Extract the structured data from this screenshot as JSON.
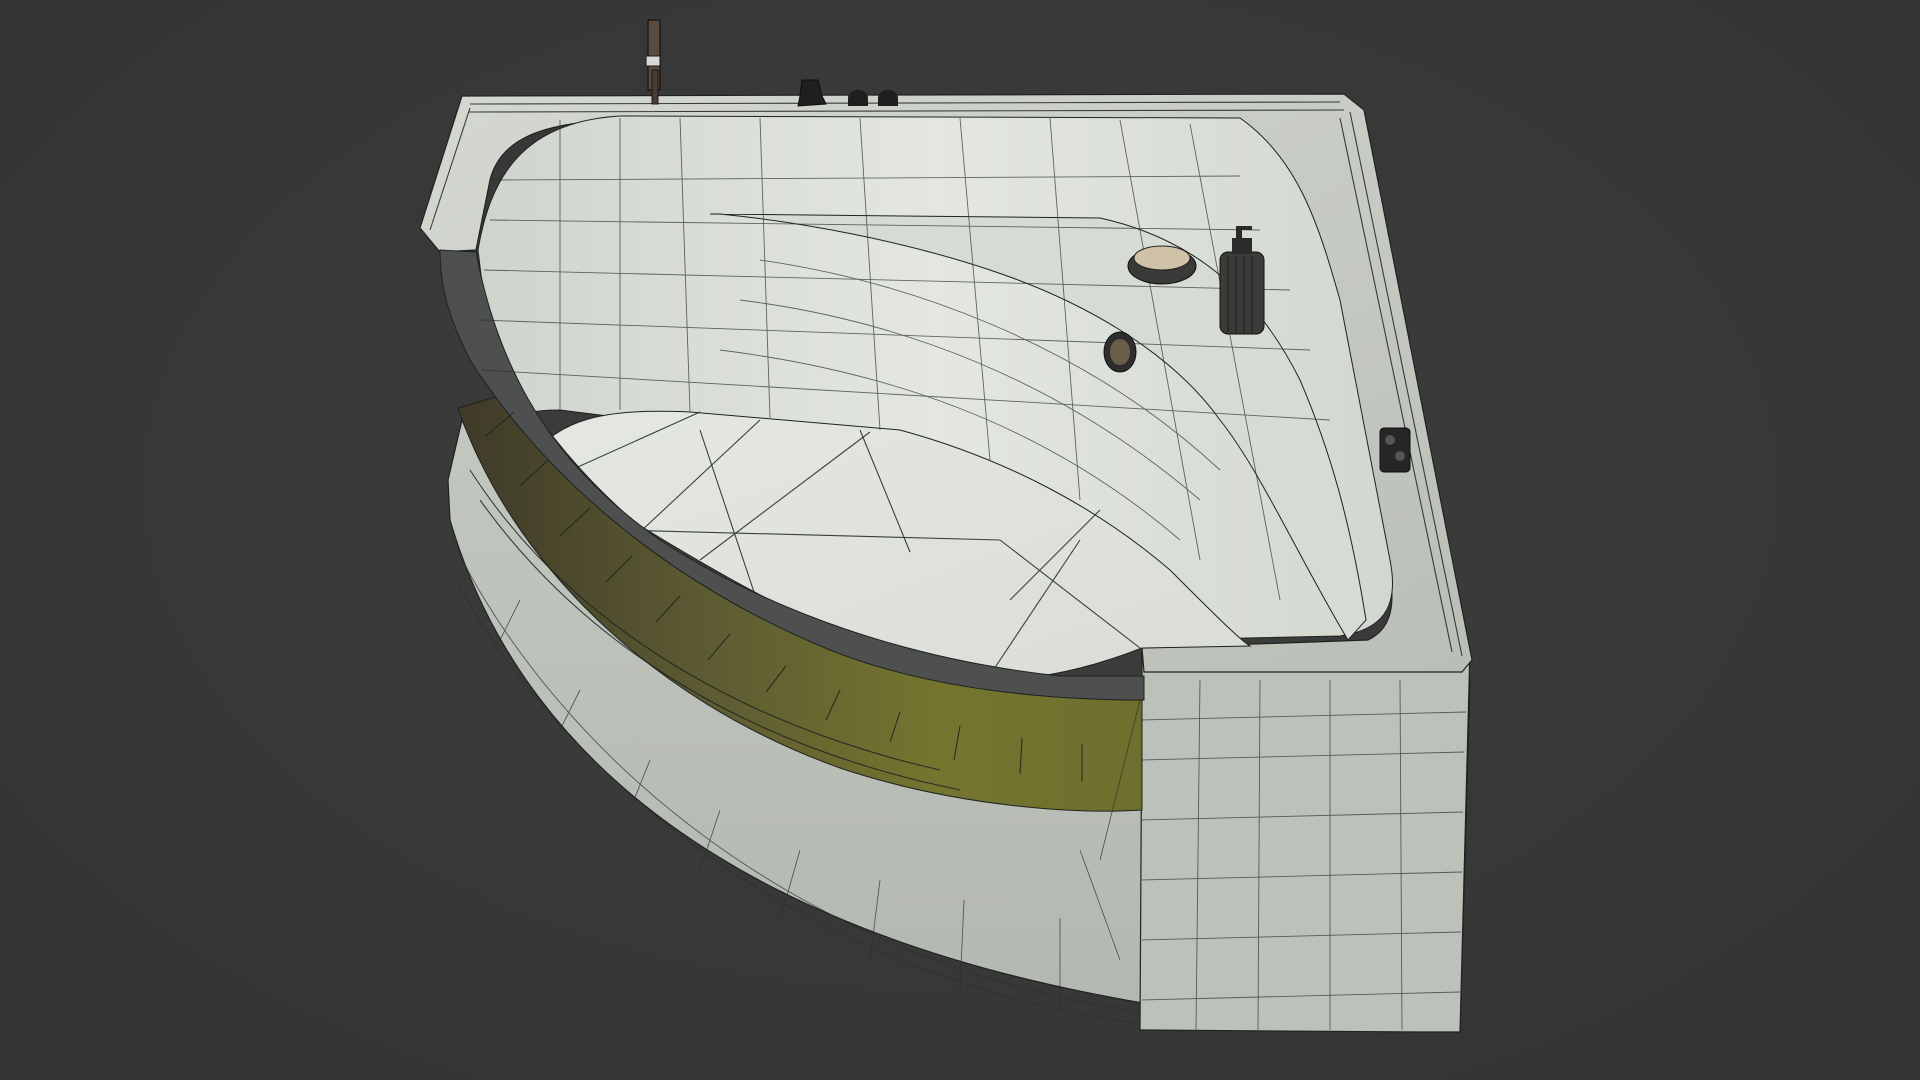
{
  "viewport": {
    "mode": "wireframe-on-shaded",
    "background_color": "#383838"
  },
  "model": {
    "object": "corner-bathtub",
    "shell_color": "#c9cec6",
    "inner_color": "#dde2db",
    "wire_color": "#1e2320",
    "panel_color": "#6b6a2c",
    "rim_trim_color": "#4a4d4b",
    "fittings": [
      {
        "name": "hand-shower-icon"
      },
      {
        "name": "mixer-tap-icon"
      },
      {
        "name": "control-knob-left-icon"
      },
      {
        "name": "control-knob-right-icon"
      },
      {
        "name": "soap-dish-icon"
      },
      {
        "name": "soap-dispenser-icon"
      },
      {
        "name": "jet-nozzle-icon"
      },
      {
        "name": "side-control-icon"
      }
    ]
  }
}
